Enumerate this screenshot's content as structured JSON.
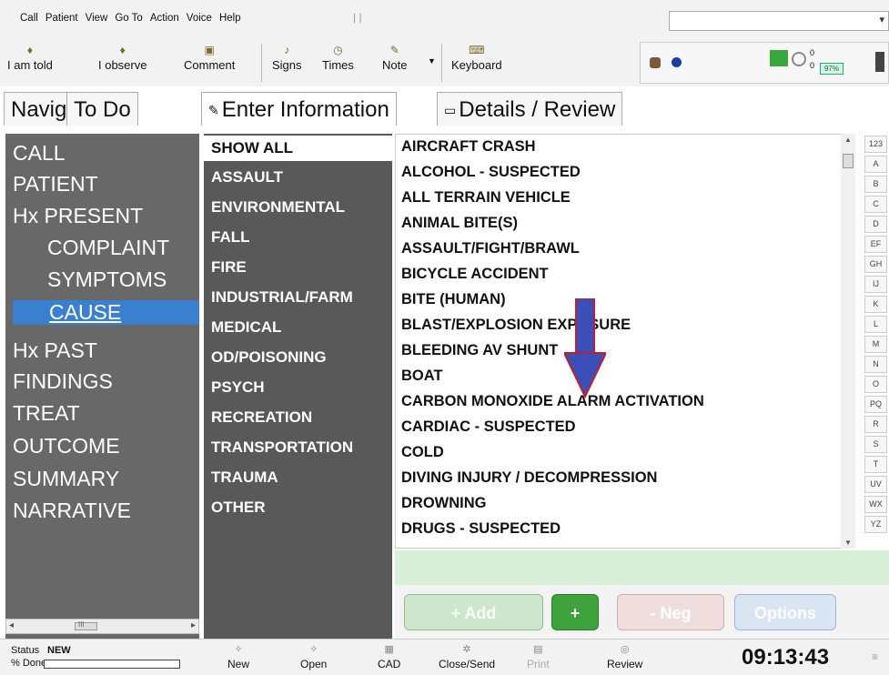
{
  "menu": {
    "items": [
      "Call",
      "Patient",
      "View",
      "Go To",
      "Action",
      "Voice",
      "Help"
    ],
    "combo_value": ""
  },
  "toolbar": {
    "buttons": [
      {
        "label": "I am told",
        "icon": "speech-icon"
      },
      {
        "label": "I observe",
        "icon": "eye-icon"
      },
      {
        "label": "Comment",
        "icon": "comment-icon"
      },
      {
        "label": "Signs",
        "icon": "signs-icon"
      },
      {
        "label": "Times",
        "icon": "clock-icon"
      },
      {
        "label": "Note",
        "icon": "note-icon"
      },
      {
        "label": "Keyboard",
        "icon": "keyboard-icon"
      }
    ],
    "status": {
      "count_top": "0",
      "count_bottom": "0",
      "battery": "97%"
    }
  },
  "tabs": {
    "navig": "Navig",
    "todo": "To Do",
    "enter": "Enter Information",
    "details": "Details / Review"
  },
  "nav": {
    "items": [
      {
        "label": "CALL",
        "indent": 0,
        "selected": false
      },
      {
        "label": "PATIENT",
        "indent": 0,
        "selected": false
      },
      {
        "label": "Hx PRESENT",
        "indent": 0,
        "selected": false
      },
      {
        "label": "COMPLAINT",
        "indent": 1,
        "selected": false
      },
      {
        "label": "SYMPTOMS",
        "indent": 1,
        "selected": false
      },
      {
        "label": "CAUSE",
        "indent": 1,
        "selected": true
      },
      {
        "label": "Hx PAST",
        "indent": 0,
        "selected": false
      },
      {
        "label": "FINDINGS",
        "indent": 0,
        "selected": false
      },
      {
        "label": "TREAT",
        "indent": 0,
        "selected": false
      },
      {
        "label": "OUTCOME",
        "indent": 0,
        "selected": false
      },
      {
        "label": "SUMMARY",
        "indent": 0,
        "selected": false
      },
      {
        "label": "NARRATIVE",
        "indent": 0,
        "selected": false
      }
    ],
    "scroll_marker": "III"
  },
  "categories": {
    "items": [
      {
        "label": "SHOW ALL",
        "selected": true
      },
      {
        "label": "ASSAULT",
        "selected": false
      },
      {
        "label": "ENVIRONMENTAL",
        "selected": false
      },
      {
        "label": "FALL",
        "selected": false
      },
      {
        "label": "FIRE",
        "selected": false
      },
      {
        "label": "INDUSTRIAL/FARM",
        "selected": false
      },
      {
        "label": "MEDICAL",
        "selected": false
      },
      {
        "label": "OD/POISONING",
        "selected": false
      },
      {
        "label": "PSYCH",
        "selected": false
      },
      {
        "label": "RECREATION",
        "selected": false
      },
      {
        "label": "TRANSPORTATION",
        "selected": false
      },
      {
        "label": "TRAUMA",
        "selected": false
      },
      {
        "label": "OTHER",
        "selected": false
      }
    ]
  },
  "causes": {
    "items": [
      "AIRCRAFT CRASH",
      "ALCOHOL - SUSPECTED",
      "ALL TERRAIN VEHICLE",
      "ANIMAL BITE(S)",
      "ASSAULT/FIGHT/BRAWL",
      "BICYCLE ACCIDENT",
      "BITE (HUMAN)",
      "BLAST/EXPLOSION EXPOSURE",
      "BLEEDING AV SHUNT",
      "BOAT",
      "CARBON MONOXIDE ALARM ACTIVATION",
      "CARDIAC - SUSPECTED",
      "COLD",
      "DIVING INJURY / DECOMPRESSION",
      "DROWNING",
      "DRUGS - SUSPECTED"
    ]
  },
  "alpha_index": [
    "123",
    "A",
    "B",
    "C",
    "D",
    "EF",
    "GH",
    "IJ",
    "K",
    "L",
    "M",
    "N",
    "O",
    "PQ",
    "R",
    "S",
    "T",
    "UV",
    "WX",
    "YZ"
  ],
  "actions": {
    "add": "+ Add",
    "plus": "+",
    "neg": "- Neg",
    "options": "Options"
  },
  "statusbar": {
    "status_label": "Status",
    "status_value": "NEW",
    "done_label": "% Done",
    "buttons": [
      {
        "label": "New",
        "disabled": false
      },
      {
        "label": "Open",
        "disabled": false
      },
      {
        "label": "CAD",
        "disabled": false
      },
      {
        "label": "Close/Send",
        "disabled": false
      },
      {
        "label": "Print",
        "disabled": true
      },
      {
        "label": "Review",
        "disabled": false
      }
    ],
    "clock": "09:13:43"
  },
  "colors": {
    "nav_bg": "#686868",
    "category_bg": "#595959",
    "selected_nav": "#3b7fd1",
    "entry_green": "#d9efd9",
    "arrow_fill": "#3b4fb8",
    "arrow_accent": "#c01f2f"
  }
}
